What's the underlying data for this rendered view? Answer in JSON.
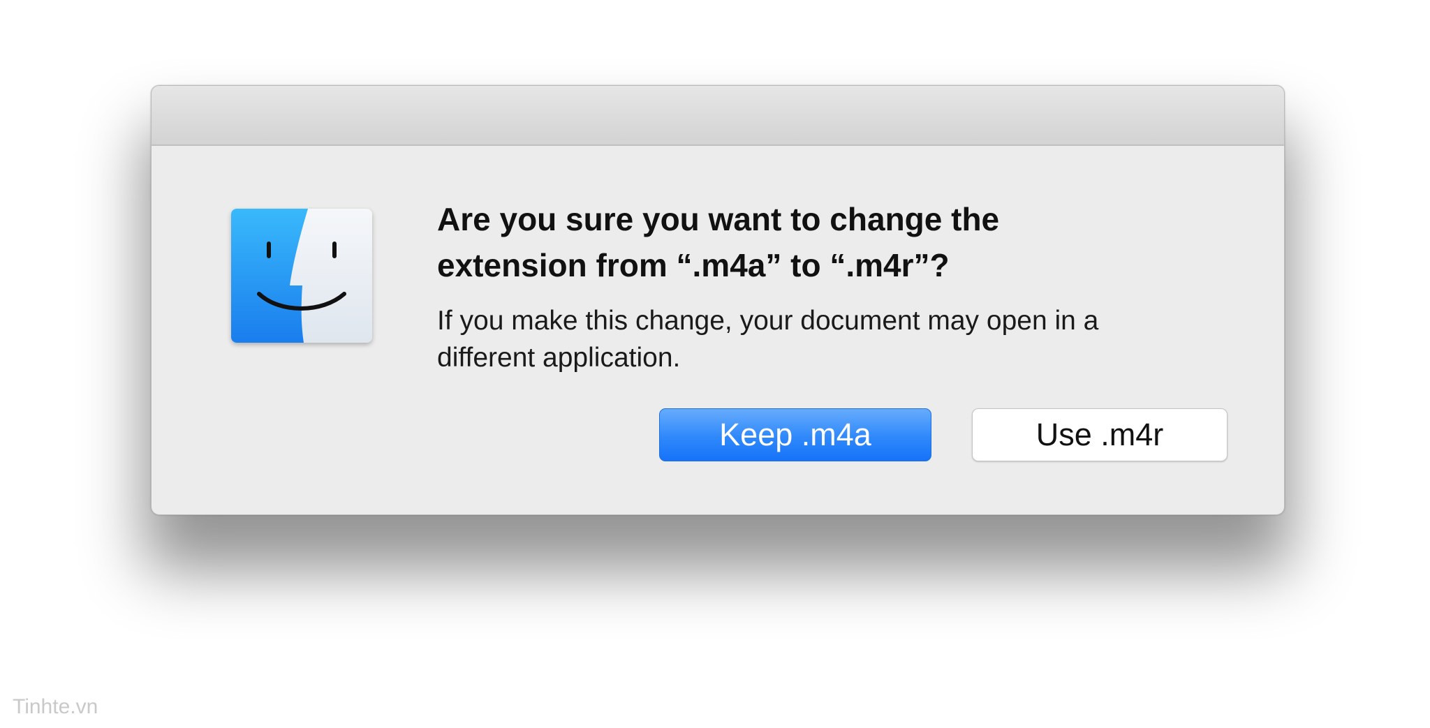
{
  "dialog": {
    "title_lines": [
      "Are you sure you want to change the",
      "extension from “.m4a” to “.m4r”?"
    ],
    "message_lines": [
      "If you make this change, your document may open in a",
      "different application."
    ],
    "buttons": {
      "keep_label": "Keep .m4a",
      "use_label": "Use .m4r"
    },
    "icon": "finder-icon"
  },
  "watermark": "Tinhte.vn",
  "colors": {
    "default_button": "#2f88fb",
    "dialog_background": "#ececec",
    "finder_blue": "#1e8ff0",
    "finder_light": "#e9eef5"
  }
}
